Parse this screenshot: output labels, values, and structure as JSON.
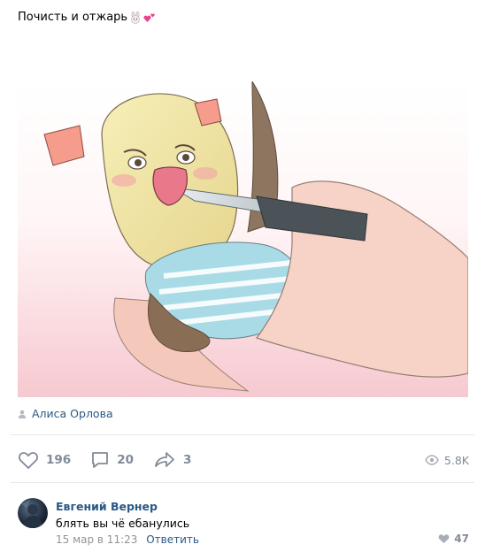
{
  "post": {
    "text": "Почисть и отжарь",
    "emoji_icons": [
      "rabbit-face-icon",
      "two-hearts-icon"
    ],
    "image_alt": "Anime illustration of a crying potato character wearing a striped top being peeled with a knife by a hand",
    "author": "Алиса Орлова"
  },
  "actions": {
    "likes": "196",
    "comments": "20",
    "shares": "3",
    "views": "5.8K"
  },
  "comment": {
    "author": "Евгений Вернер",
    "text": "блять вы чё ебанулись",
    "date": "15 мар в 11:23",
    "reply_label": "Ответить",
    "likes": "47"
  },
  "colors": {
    "link": "#2a5885",
    "muted": "#828a99",
    "divider": "#e7e8ec"
  }
}
